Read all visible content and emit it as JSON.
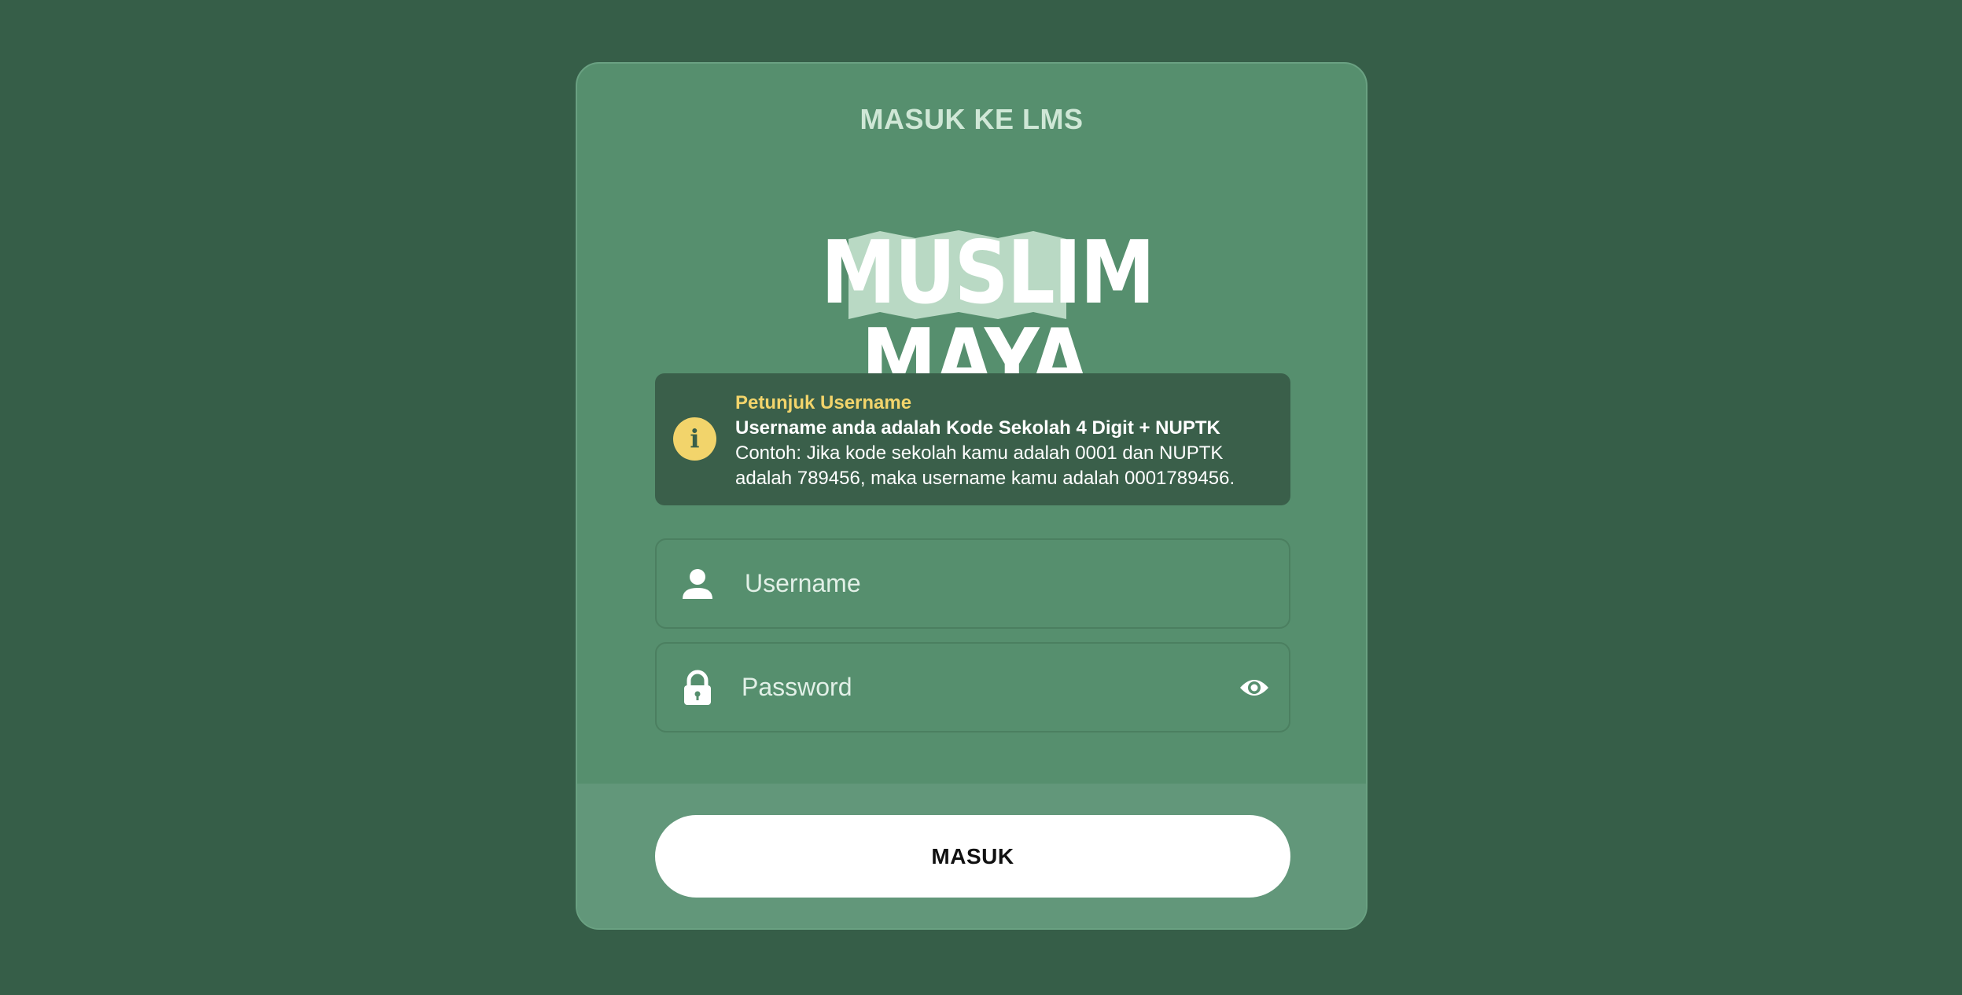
{
  "page": {
    "title": "MASUK KE LMS"
  },
  "logo": {
    "line1": "MUSLIM",
    "line2": "MAYA"
  },
  "info": {
    "icon": "info-icon",
    "heading": "Petunjuk Username",
    "strong": "Username anda adalah Kode Sekolah 4 Digit + NUPTK",
    "example": "Contoh: Jika kode sekolah kamu adalah 0001 dan NUPTK adalah 789456, maka username kamu adalah 0001789456."
  },
  "form": {
    "username": {
      "icon": "user-icon",
      "placeholder": "Username",
      "value": ""
    },
    "password": {
      "icon": "lock-icon",
      "placeholder": "Password",
      "value": "",
      "toggle_icon": "eye-icon"
    },
    "submit_label": "MASUK"
  },
  "colors": {
    "background": "#365e48",
    "card": "#568f6e",
    "footer": "#62977a",
    "info_box": "#3a5f4a",
    "accent": "#f2d46b"
  }
}
